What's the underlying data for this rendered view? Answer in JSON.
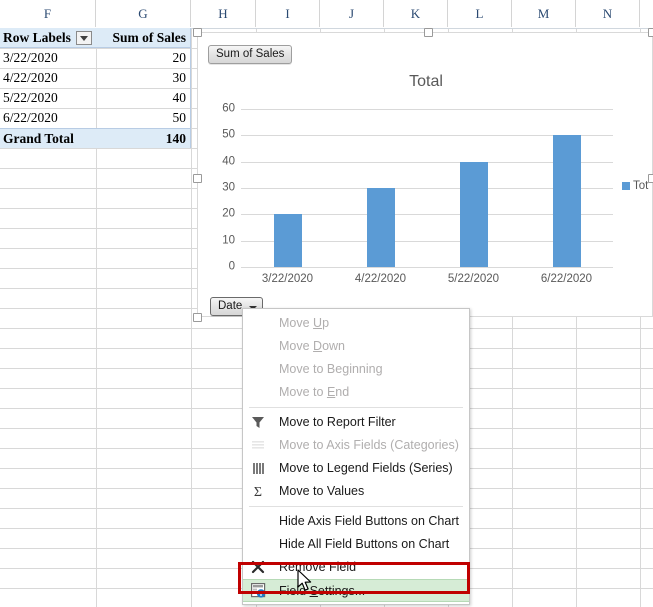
{
  "spreadsheet": {
    "column_headers": [
      "F",
      "G",
      "H",
      "I",
      "J",
      "K",
      "L",
      "M",
      "N"
    ],
    "pivot_table": {
      "header": {
        "label": "Row Labels",
        "value": "Sum of Sales",
        "filter_icon": "filter-dropdown-icon"
      },
      "rows": [
        {
          "label": "3/22/2020",
          "value": "20"
        },
        {
          "label": "4/22/2020",
          "value": "30"
        },
        {
          "label": "5/22/2020",
          "value": "40"
        },
        {
          "label": "6/22/2020",
          "value": "50"
        }
      ],
      "grand_total": {
        "label": "Grand Total",
        "value": "140"
      }
    }
  },
  "chart": {
    "title": "Total",
    "value_field_button": "Sum of Sales",
    "axis_field_button": "Date",
    "legend": [
      {
        "label": "Tot",
        "color": "#5b9bd5"
      }
    ],
    "accent_color": "#5b9bd5"
  },
  "chart_data": {
    "type": "bar",
    "title": "Total",
    "categories": [
      "3/22/2020",
      "4/22/2020",
      "5/22/2020",
      "6/22/2020"
    ],
    "values": [
      20,
      30,
      40,
      50
    ],
    "series": [
      {
        "name": "Total",
        "values": [
          20,
          30,
          40,
          50
        ]
      }
    ],
    "xlabel": "",
    "ylabel": "",
    "ylim": [
      0,
      60
    ],
    "yticks": [
      0,
      10,
      20,
      30,
      40,
      50,
      60
    ],
    "grid": true,
    "legend_position": "right",
    "bar_color": "#5b9bd5"
  },
  "context_menu": {
    "items": [
      {
        "label": "Move Up",
        "underline": "U",
        "disabled": true,
        "icon": null,
        "separator_after": false
      },
      {
        "label": "Move Down",
        "underline": "D",
        "disabled": true,
        "icon": null,
        "separator_after": false
      },
      {
        "label": "Move to Beginning",
        "underline": "g",
        "disabled": true,
        "icon": null,
        "separator_after": false
      },
      {
        "label": "Move to End",
        "underline": "E",
        "disabled": true,
        "icon": null,
        "separator_after": true
      },
      {
        "label": "Move to Report Filter",
        "disabled": false,
        "icon": "funnel-icon",
        "separator_after": false
      },
      {
        "label": "Move to Axis Fields (Categories)",
        "disabled": true,
        "icon": "axis-fields-icon",
        "separator_after": false
      },
      {
        "label": "Move to Legend Fields (Series)",
        "disabled": false,
        "icon": "legend-fields-icon",
        "separator_after": false
      },
      {
        "label": "Move to Values",
        "disabled": false,
        "icon": "sigma-icon",
        "separator_after": true
      },
      {
        "label": "Hide Axis Field Buttons on Chart",
        "disabled": false,
        "icon": null,
        "separator_after": false
      },
      {
        "label": "Hide All Field Buttons on Chart",
        "disabled": false,
        "icon": null,
        "separator_after": false
      },
      {
        "label": "Remove Field",
        "disabled": false,
        "icon": "x-icon",
        "separator_after": false
      },
      {
        "label": "Field Settings...",
        "underline": "S",
        "disabled": false,
        "icon": "field-settings-icon",
        "highlighted": true,
        "separator_after": false
      }
    ]
  },
  "annotation": {
    "highlight_color": "#c00000",
    "target": "Field Settings..."
  }
}
